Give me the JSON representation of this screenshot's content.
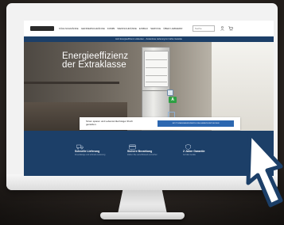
{
  "browser": {
    "nav_links": [
      "KÜHLSCHRÄNKE",
      "GEFRIERSCHRÄNKE",
      "KOMBI",
      "WEINSCHRÄNKE",
      "EINBAU",
      "SERVICE",
      "ÜBER LIEBHERR"
    ],
    "search_placeholder": "Suche",
    "promo_text": "Jetzt Energieeffizienz entdecken – Kostenlose Lieferung & 2 Jahre Garantie"
  },
  "hero": {
    "title_line1": "Energieeffizienz",
    "title_line2": "der Extraklasse",
    "energy_class": "A"
  },
  "search_card": {
    "question": "Strom sparen und Lebensmittel länger frisch genießen.",
    "button_label": "JETZT ENERGIEEFFIZIENTE KÜHLGERÄTE ENTDECKEN"
  },
  "features": [
    {
      "icon": "truck-icon",
      "title": "Schnelle Lieferung",
      "desc": "Zuverlässige und schnelle Lieferung"
    },
    {
      "icon": "card-icon",
      "title": "Sichere Bezahlung",
      "desc": "Zahlen Sie verschlüsselt und sicher"
    },
    {
      "icon": "shield-icon",
      "title": "2 Jahre Garantie",
      "desc": "Auf alle Geräte"
    }
  ],
  "colors": {
    "brand_navy": "#1c3f68",
    "button_blue": "#2c67b0",
    "energy_green": "#2ea043"
  }
}
